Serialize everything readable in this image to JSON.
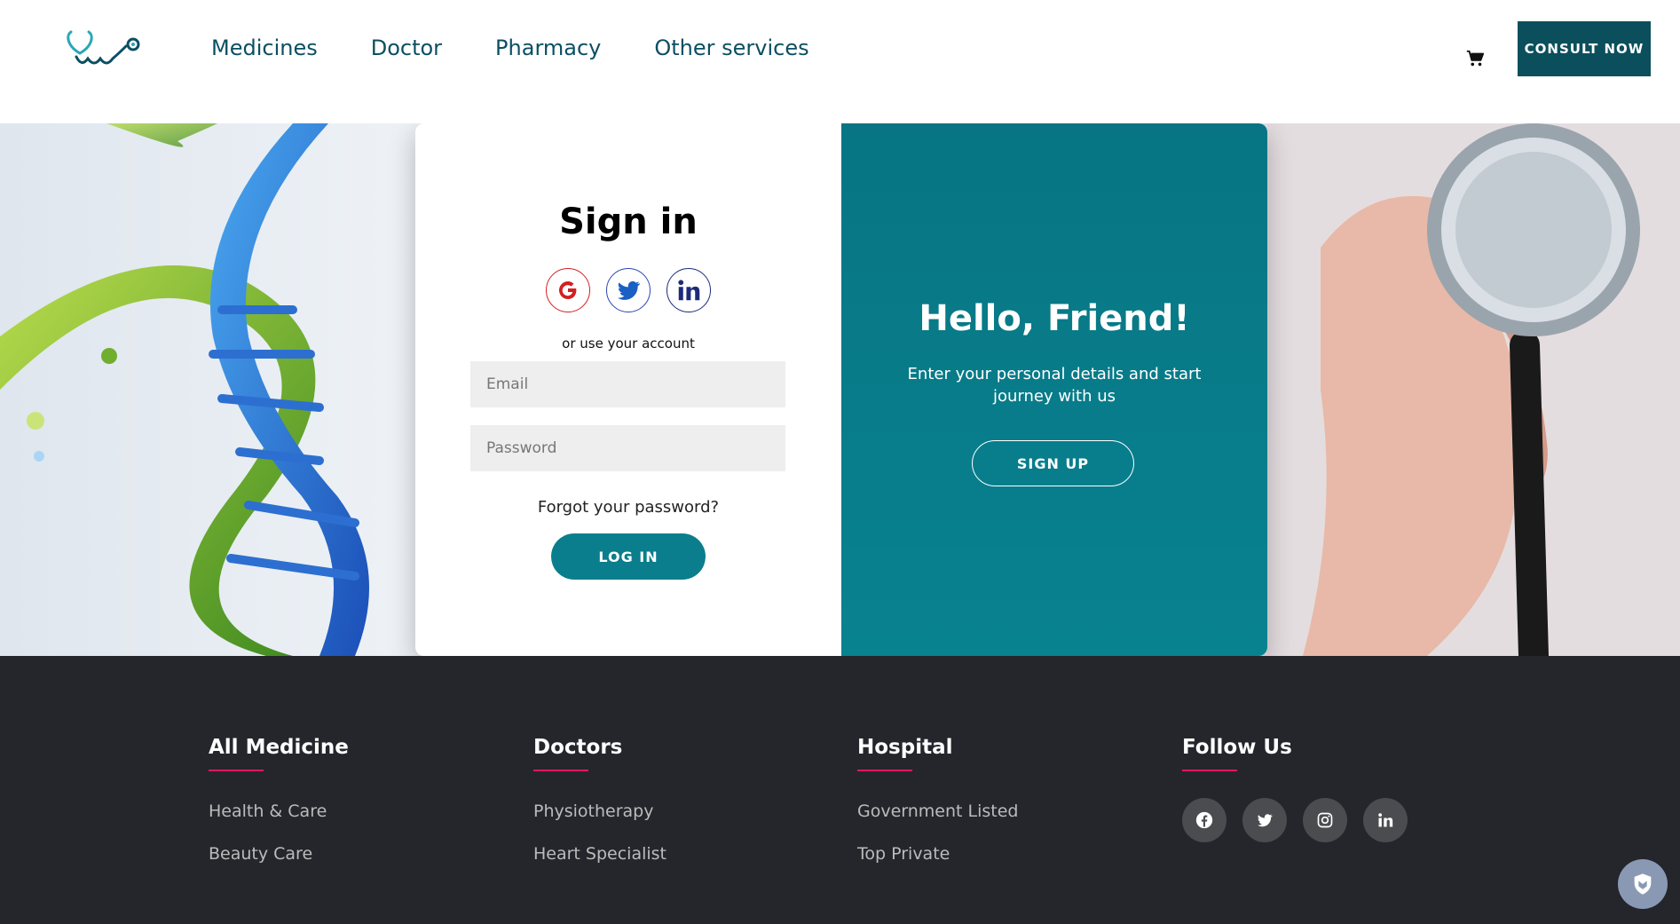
{
  "header": {
    "nav": [
      "Medicines",
      "Doctor",
      "Pharmacy",
      "Other services"
    ],
    "consult_label": "CONSULT NOW"
  },
  "signin": {
    "title": "Sign in",
    "social_icons": [
      "google-icon",
      "twitter-icon",
      "linkedin-icon"
    ],
    "alt_text": "or use your account",
    "email_placeholder": "Email",
    "password_placeholder": "Password",
    "forgot_label": "Forgot your password?",
    "login_label": "LOG IN"
  },
  "welcome": {
    "title": "Hello, Friend!",
    "text": "Enter your personal details and start journey with us",
    "signup_label": "SIGN UP"
  },
  "footer": {
    "columns": [
      {
        "title": "All Medicine",
        "links": [
          "Health & Care",
          "Beauty Care"
        ]
      },
      {
        "title": "Doctors",
        "links": [
          "Physiotherapy",
          "Heart Specialist"
        ]
      },
      {
        "title": "Hospital",
        "links": [
          "Government Listed",
          "Top Private"
        ]
      }
    ],
    "follow_title": "Follow Us",
    "follow_icons": [
      "facebook-icon",
      "twitter-icon",
      "instagram-icon",
      "linkedin-icon"
    ]
  },
  "colors": {
    "brand": "#0b4f5c",
    "accent": "#0a7e8c",
    "footer_bg": "#24262c",
    "footer_underline": "#e0195e"
  }
}
